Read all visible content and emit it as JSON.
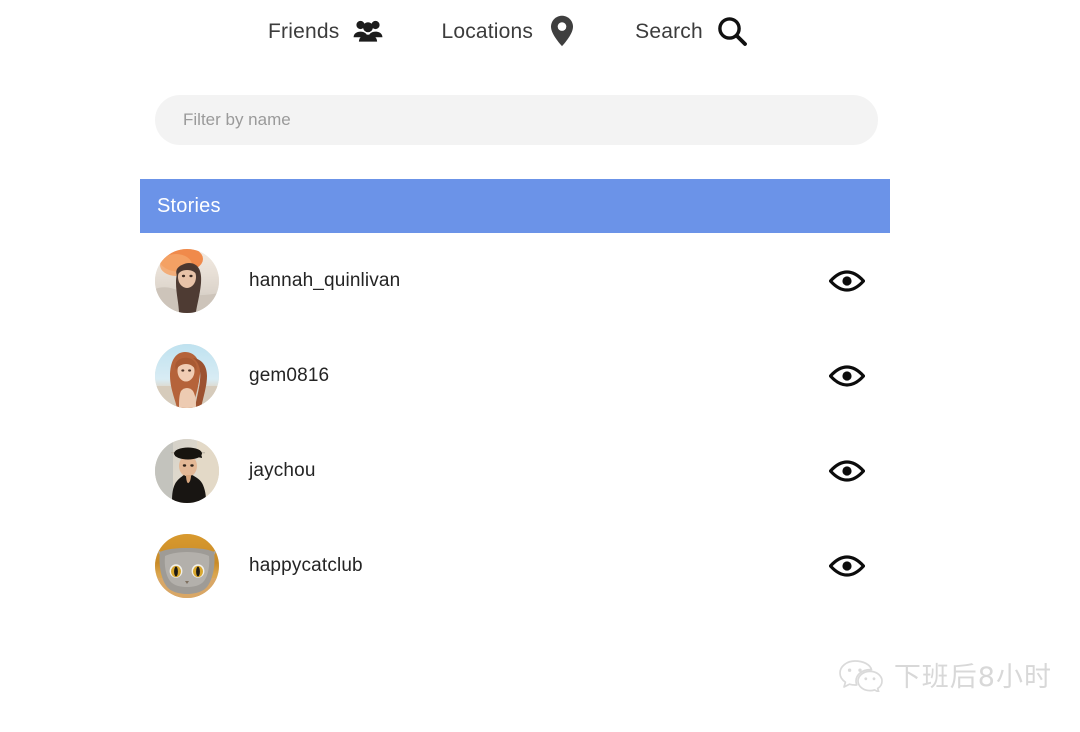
{
  "nav": {
    "items": [
      {
        "label": "Friends",
        "icon": "people-group-icon"
      },
      {
        "label": "Locations",
        "icon": "location-pin-icon"
      },
      {
        "label": "Search",
        "icon": "magnifier-icon"
      }
    ]
  },
  "filter": {
    "placeholder": "Filter by name",
    "value": ""
  },
  "section": {
    "title": "Stories",
    "color": "#6b93e8"
  },
  "list": {
    "rows": [
      {
        "name": "hannah_quinlivan",
        "avatar": "avatar-hannah",
        "action_icon": "eye-icon"
      },
      {
        "name": "gem0816",
        "avatar": "avatar-gem",
        "action_icon": "eye-icon"
      },
      {
        "name": "jaychou",
        "avatar": "avatar-jaychou",
        "action_icon": "eye-icon"
      },
      {
        "name": "happycatclub",
        "avatar": "avatar-cat",
        "action_icon": "eye-icon"
      }
    ]
  },
  "watermark": {
    "text": "下班后8小时",
    "icon": "wechat-icon"
  },
  "colors": {
    "accent": "#6b93e8",
    "field_bg": "#f3f3f3",
    "text": "#242424",
    "placeholder": "#9a9a9a"
  }
}
